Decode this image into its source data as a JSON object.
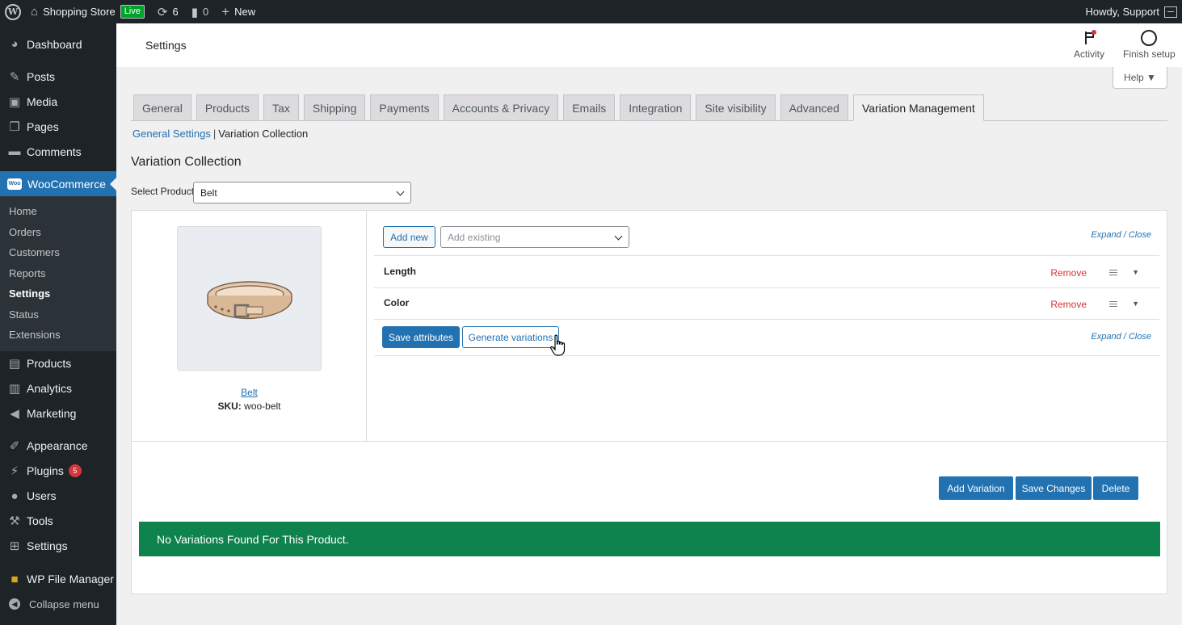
{
  "admin_bar": {
    "site_name": "Shopping Store",
    "live_badge": "Live",
    "updates_count": "6",
    "comments_count": "0",
    "new_label": "New",
    "howdy": "Howdy, Support"
  },
  "sidebar": {
    "dashboard": "Dashboard",
    "posts": "Posts",
    "media": "Media",
    "pages": "Pages",
    "comments": "Comments",
    "woocommerce": "WooCommerce",
    "woo_badge": "Woo",
    "woo_sub": [
      "Home",
      "Orders",
      "Customers",
      "Reports",
      "Settings",
      "Status",
      "Extensions"
    ],
    "products": "Products",
    "analytics": "Analytics",
    "marketing": "Marketing",
    "appearance": "Appearance",
    "plugins": "Plugins",
    "plugins_count": "5",
    "users": "Users",
    "tools": "Tools",
    "settings": "Settings",
    "wp_file_manager": "WP File Manager",
    "collapse": "Collapse menu"
  },
  "header": {
    "title": "Settings",
    "activity": "Activity",
    "finish_setup": "Finish setup",
    "help": "Help ▼"
  },
  "tabs": [
    "General",
    "Products",
    "Tax",
    "Shipping",
    "Payments",
    "Accounts & Privacy",
    "Emails",
    "Integration",
    "Site visibility",
    "Advanced",
    "Variation Management"
  ],
  "subnav": {
    "general_settings": "General Settings",
    "separator": "|",
    "current": "Variation Collection"
  },
  "section": {
    "title": "Variation Collection",
    "select_label": "Select Product",
    "select_value": "Belt"
  },
  "product": {
    "name": "Belt",
    "sku_label": "SKU:",
    "sku": "woo-belt"
  },
  "attributes": {
    "add_new": "Add new",
    "add_existing_placeholder": "Add existing",
    "expand_close": "Expand / Close",
    "rows": [
      {
        "name": "Length",
        "remove": "Remove"
      },
      {
        "name": "Color",
        "remove": "Remove"
      }
    ],
    "save_attributes": "Save attributes",
    "generate_variations": "Generate variations"
  },
  "actions": {
    "add_variation": "Add Variation",
    "save_changes": "Save Changes",
    "delete": "Delete"
  },
  "notice": "No Variations Found For This Product.",
  "colors": {
    "admin_dark": "#1d2327",
    "accent_blue": "#2271b1",
    "notice_green": "#0f834d",
    "remove_red": "#d63638"
  }
}
